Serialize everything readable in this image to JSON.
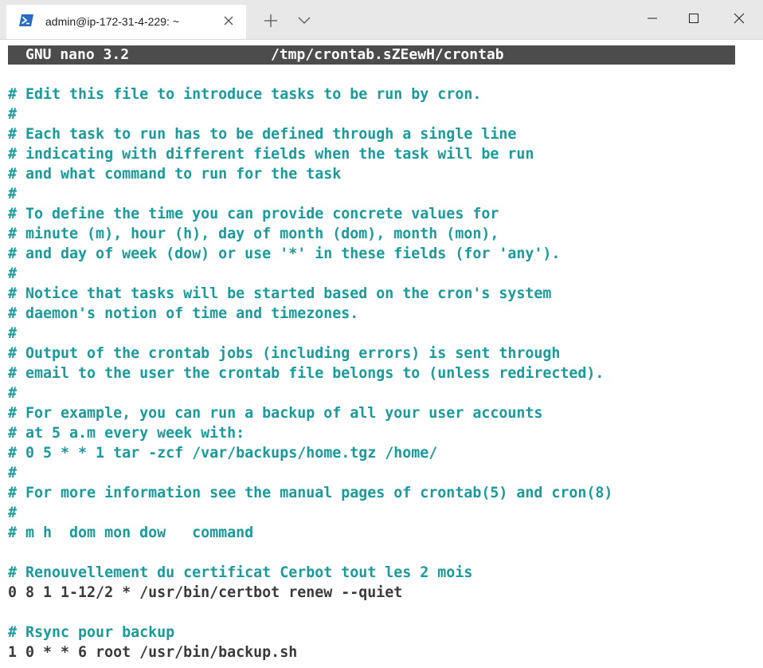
{
  "window": {
    "tab_title": "admin@ip-172-31-4-229: ~",
    "tab_icon": "powershell-icon"
  },
  "editor": {
    "app_version": "GNU nano 3.2",
    "filename": "/tmp/crontab.sZEewH/crontab",
    "lines": [
      {
        "type": "comment",
        "text": "# Edit this file to introduce tasks to be run by cron."
      },
      {
        "type": "comment",
        "text": "#"
      },
      {
        "type": "comment",
        "text": "# Each task to run has to be defined through a single line"
      },
      {
        "type": "comment",
        "text": "# indicating with different fields when the task will be run"
      },
      {
        "type": "comment",
        "text": "# and what command to run for the task"
      },
      {
        "type": "comment",
        "text": "#"
      },
      {
        "type": "comment",
        "text": "# To define the time you can provide concrete values for"
      },
      {
        "type": "comment",
        "text": "# minute (m), hour (h), day of month (dom), month (mon),"
      },
      {
        "type": "comment",
        "text": "# and day of week (dow) or use '*' in these fields (for 'any')."
      },
      {
        "type": "comment",
        "text": "#"
      },
      {
        "type": "comment",
        "text": "# Notice that tasks will be started based on the cron's system"
      },
      {
        "type": "comment",
        "text": "# daemon's notion of time and timezones."
      },
      {
        "type": "comment",
        "text": "#"
      },
      {
        "type": "comment",
        "text": "# Output of the crontab jobs (including errors) is sent through"
      },
      {
        "type": "comment",
        "text": "# email to the user the crontab file belongs to (unless redirected)."
      },
      {
        "type": "comment",
        "text": "#"
      },
      {
        "type": "comment",
        "text": "# For example, you can run a backup of all your user accounts"
      },
      {
        "type": "comment",
        "text": "# at 5 a.m every week with:"
      },
      {
        "type": "comment",
        "text": "# 0 5 * * 1 tar -zcf /var/backups/home.tgz /home/"
      },
      {
        "type": "comment",
        "text": "#"
      },
      {
        "type": "comment",
        "text": "# For more information see the manual pages of crontab(5) and cron(8)"
      },
      {
        "type": "comment",
        "text": "#"
      },
      {
        "type": "comment",
        "text": "# m h  dom mon dow   command"
      },
      {
        "type": "blank",
        "text": ""
      },
      {
        "type": "comment",
        "text": "# Renouvellement du certificat Cerbot tout les 2 mois"
      },
      {
        "type": "code",
        "text": "0 8 1 1-12/2 * /usr/bin/certbot renew --quiet"
      },
      {
        "type": "blank",
        "text": ""
      },
      {
        "type": "comment",
        "text": "# Rsync pour backup"
      },
      {
        "type": "code",
        "text": "1 0 * * 6 root /usr/bin/backup.sh"
      }
    ]
  },
  "colors": {
    "comment": "#1a9a9a",
    "code": "#3a3a3a",
    "header_bg": "#4c4c4c",
    "header_fg": "#ffffff",
    "titlebar_bg": "#e8e8e8"
  }
}
